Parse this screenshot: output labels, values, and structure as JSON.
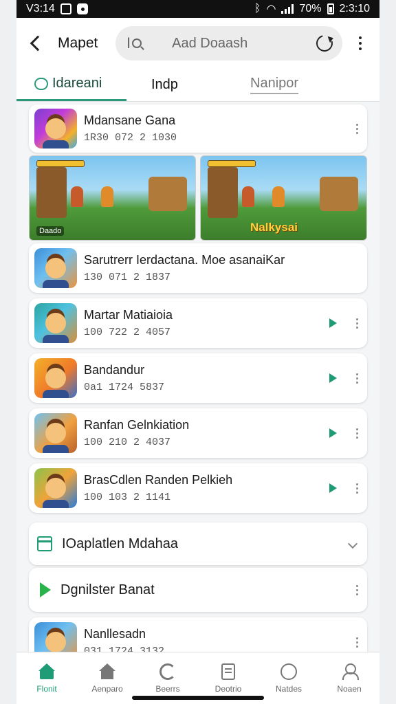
{
  "status": {
    "time": "V3:14",
    "battery": "70%",
    "clock": "2:3:10"
  },
  "header": {
    "title": "Mapet",
    "search_prefix": "I",
    "search_text": "Aad Doaash"
  },
  "tabs": [
    {
      "label": "Idareani"
    },
    {
      "label": "Indp"
    },
    {
      "label": "Nanipor"
    }
  ],
  "apps": [
    {
      "name": "Mdansane Gana",
      "sub": "1R30 072 2 1030"
    },
    {
      "name": "Sarutrerr Ierdactana. Moe asanaiKar",
      "sub": "130 071 2 1837"
    },
    {
      "name": "Martar Matiaioia",
      "sub": "100 722 2 4057"
    },
    {
      "name": "Bandandur",
      "sub": "0a1 1724 5837"
    },
    {
      "name": "Ranfan Gelnkiation",
      "sub": "100 210 2 4037"
    },
    {
      "name": "BrasCdlen Randen Pelkieh",
      "sub": "100 103 2 1141"
    }
  ],
  "screenshots": [
    {
      "caption": "Daado",
      "badge": ""
    },
    {
      "caption": "",
      "badge": "Nalkysai"
    }
  ],
  "sections": [
    {
      "title": "IOaplatlen Mdahaa"
    },
    {
      "title": "Dgnilster Banat"
    }
  ],
  "last_app": {
    "name": "Nanllesadn",
    "sub": "031 1724 3132"
  },
  "nav": [
    {
      "label": "Flonit"
    },
    {
      "label": "Aenparo"
    },
    {
      "label": "Beerrs"
    },
    {
      "label": "Deotrio"
    },
    {
      "label": "Natdes"
    },
    {
      "label": "Noaen"
    }
  ],
  "colors": {
    "accent": "#1f9b76",
    "status_bar": "#111111"
  }
}
